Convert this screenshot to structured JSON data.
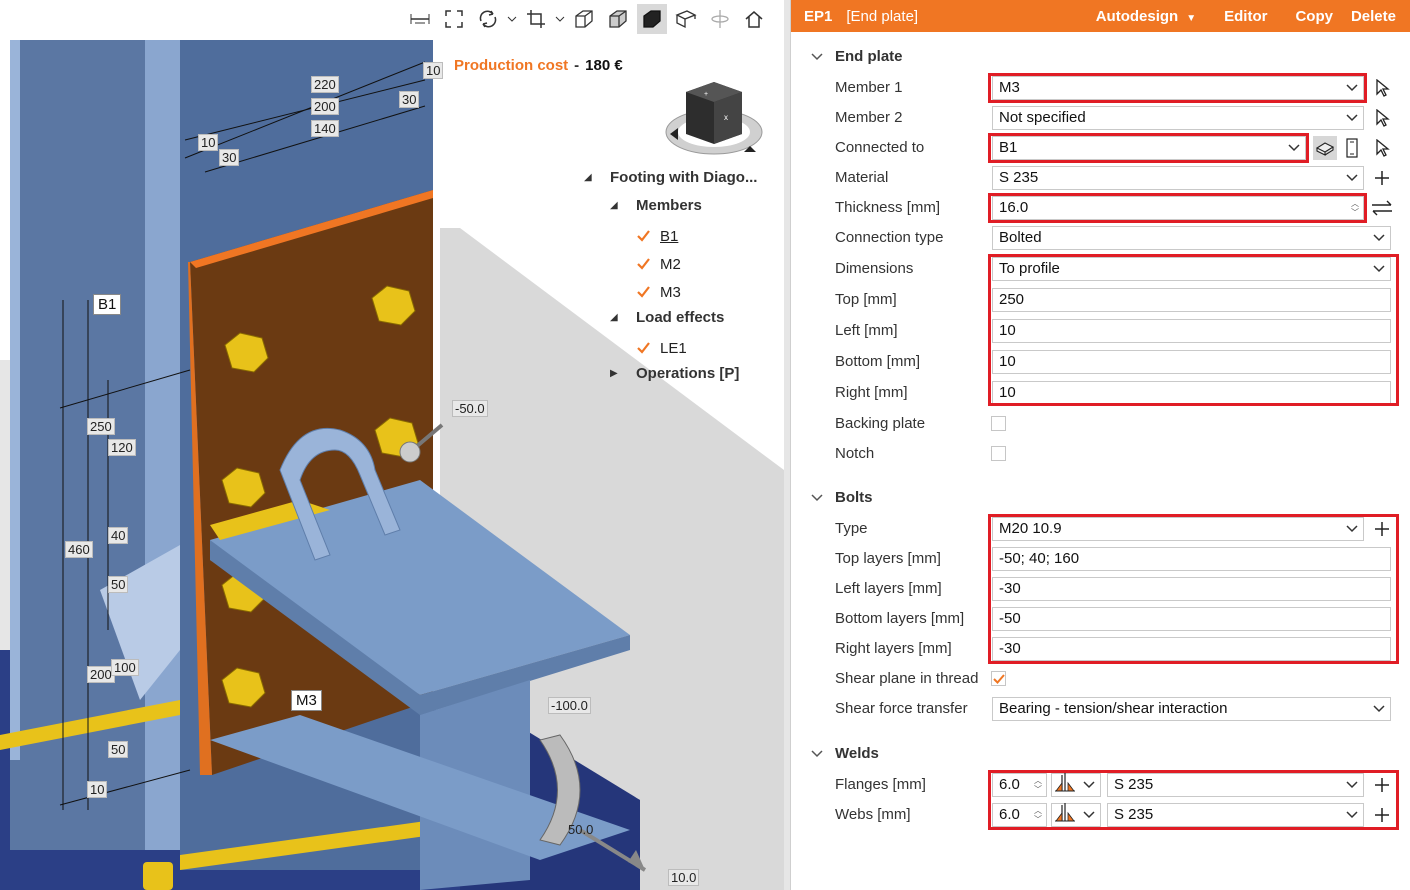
{
  "toolbar": {
    "icons": [
      "dimension-icon",
      "fit-view-icon",
      "rotate-icon",
      "crop-icon",
      "wireframe-icon",
      "transparent-icon",
      "solid-icon",
      "section-icon",
      "axis-icon",
      "home-icon"
    ]
  },
  "production_cost": {
    "label": "Production cost",
    "separator": "-",
    "value": "180 €"
  },
  "dimensions": {
    "d220": "220",
    "d200": "200",
    "d140": "140",
    "d10a": "10",
    "d30a": "30",
    "d10b": "10",
    "d30b": "30",
    "d250": "250",
    "d120": "120",
    "d460": "460",
    "d40": "40",
    "d50a": "50",
    "d200b": "200",
    "d100": "100",
    "d50b": "50",
    "d10c": "10"
  },
  "member_labels": {
    "b1": "B1",
    "m3": "M3"
  },
  "load_labels": {
    "n50": "-50.0",
    "n100": "-100.0",
    "p50": "50.0",
    "p10": "10.0"
  },
  "tree": {
    "root": "Footing with Diago...",
    "members_group": "Members",
    "members": [
      "B1",
      "M2",
      "M3"
    ],
    "load_group": "Load effects",
    "loads": [
      "LE1"
    ],
    "operations": "Operations [P]"
  },
  "panel": {
    "id": "EP1",
    "title": "[End plate]",
    "actions": {
      "autodesign": "Autodesign",
      "editor": "Editor",
      "copy": "Copy",
      "delete": "Delete"
    },
    "sections": {
      "end_plate": "End plate",
      "bolts": "Bolts",
      "welds": "Welds"
    },
    "end_plate": {
      "member1_label": "Member 1",
      "member1_value": "M3",
      "member2_label": "Member 2",
      "member2_value": "Not specified",
      "connected_label": "Connected to",
      "connected_value": "B1",
      "material_label": "Material",
      "material_value": "S 235",
      "thickness_label": "Thickness [mm]",
      "thickness_value": "16.0",
      "conn_type_label": "Connection type",
      "conn_type_value": "Bolted",
      "dimensions_label": "Dimensions",
      "dimensions_value": "To profile",
      "top_label": "Top [mm]",
      "top_value": "250",
      "left_label": "Left [mm]",
      "left_value": "10",
      "bottom_label": "Bottom [mm]",
      "bottom_value": "10",
      "right_label": "Right [mm]",
      "right_value": "10",
      "backing_label": "Backing plate",
      "notch_label": "Notch"
    },
    "bolts": {
      "type_label": "Type",
      "type_value": "M20 10.9",
      "top_layers_label": "Top layers [mm]",
      "top_layers_value": "-50; 40; 160",
      "left_layers_label": "Left layers [mm]",
      "left_layers_value": "-30",
      "bottom_layers_label": "Bottom layers [mm]",
      "bottom_layers_value": "-50",
      "right_layers_label": "Right layers [mm]",
      "right_layers_value": "-30",
      "shear_plane_label": "Shear plane in thread",
      "shear_force_label": "Shear force transfer",
      "shear_force_value": "Bearing - tension/shear interaction"
    },
    "welds": {
      "flanges_label": "Flanges [mm]",
      "flanges_size": "6.0",
      "flanges_material": "S 235",
      "webs_label": "Webs [mm]",
      "webs_size": "6.0",
      "webs_material": "S 235"
    }
  },
  "colors": {
    "accent": "#f07623",
    "highlight": "#e01d25",
    "steel": "#7b9cc8",
    "plate": "#6b3a12",
    "bolt": "#e8c21a",
    "base": "#2b3f86"
  }
}
